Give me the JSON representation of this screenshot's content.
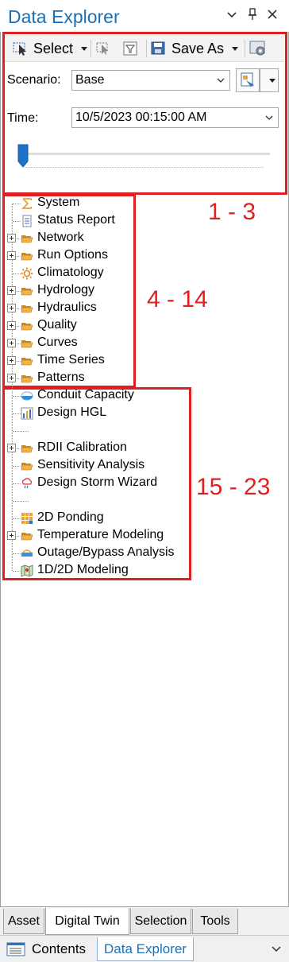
{
  "window": {
    "title": "Data Explorer",
    "controls": [
      "chevron-down-icon",
      "pin-icon",
      "close-icon"
    ]
  },
  "toolbar": {
    "select_label": "Select",
    "save_as_label": "Save As"
  },
  "scenario": {
    "label": "Scenario:",
    "value": "Base"
  },
  "time": {
    "label": "Time:",
    "value": "10/5/2023 00:15:00 AM",
    "slider_position": 0.0
  },
  "tree": {
    "items": [
      {
        "label": "System",
        "expandable": false,
        "icon": "sigma-icon"
      },
      {
        "label": "Status Report",
        "expandable": false,
        "icon": "report-icon"
      },
      {
        "label": "Network",
        "expandable": true,
        "icon": "folder-icon"
      },
      {
        "label": "Run Options",
        "expandable": true,
        "icon": "folder-icon"
      },
      {
        "label": "Climatology",
        "expandable": false,
        "icon": "sun-icon"
      },
      {
        "label": "Hydrology",
        "expandable": true,
        "icon": "folder-icon"
      },
      {
        "label": "Hydraulics",
        "expandable": true,
        "icon": "folder-icon"
      },
      {
        "label": "Quality",
        "expandable": true,
        "icon": "folder-icon"
      },
      {
        "label": "Curves",
        "expandable": true,
        "icon": "folder-icon"
      },
      {
        "label": "Time Series",
        "expandable": true,
        "icon": "folder-icon"
      },
      {
        "label": "Patterns",
        "expandable": true,
        "icon": "folder-icon"
      },
      {
        "label": "Conduit Capacity",
        "expandable": false,
        "icon": "capacity-icon"
      },
      {
        "label": "Design HGL",
        "expandable": false,
        "icon": "bar-chart-icon"
      },
      {
        "label": "",
        "expandable": false,
        "icon": "separator"
      },
      {
        "label": "RDII Calibration",
        "expandable": true,
        "icon": "folder-icon"
      },
      {
        "label": "Sensitivity Analysis",
        "expandable": false,
        "icon": "folder-icon"
      },
      {
        "label": "Design Storm Wizard",
        "expandable": false,
        "icon": "cloud-rain-icon"
      },
      {
        "label": "",
        "expandable": false,
        "icon": "separator"
      },
      {
        "label": "2D Ponding",
        "expandable": false,
        "icon": "grid-icon"
      },
      {
        "label": "Temperature Modeling",
        "expandable": true,
        "icon": "folder-icon"
      },
      {
        "label": "Outage/Bypass Analysis",
        "expandable": false,
        "icon": "bypass-icon"
      },
      {
        "label": "1D/2D Modeling",
        "expandable": false,
        "icon": "map-icon"
      }
    ]
  },
  "annotations": {
    "group1": "1 - 3",
    "group2": "4 - 14",
    "group3": "15 - 23"
  },
  "bottom_tabs": [
    "Asset",
    "Digital Twin",
    "Selection",
    "Tools"
  ],
  "active_bottom_tab": "Digital Twin",
  "dock_tabs": {
    "contents": "Contents",
    "data_explorer": "Data Explorer"
  },
  "colors": {
    "title": "#1a6fb5",
    "annotation": "#e02020",
    "folder": "#e8a33c",
    "selection_border": "#8bb4dc"
  }
}
